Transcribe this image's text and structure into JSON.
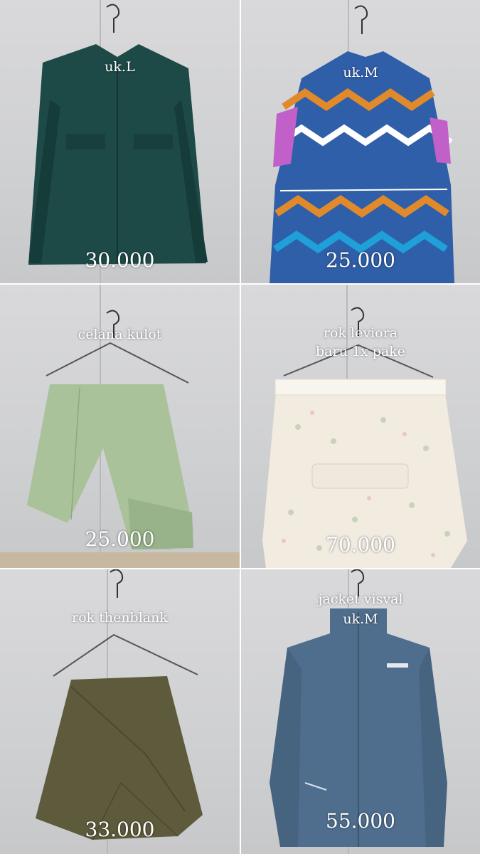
{
  "items": [
    {
      "label": "uk.L",
      "price": "30.000"
    },
    {
      "label": "uk.M",
      "price": "25.000"
    },
    {
      "label": "celana kulot",
      "price": "25.000"
    },
    {
      "label_line1": "rok leviora",
      "label_line2": "baru 1x pake",
      "price": "70.000"
    },
    {
      "label": "rok thenblank",
      "price": "33.000"
    },
    {
      "label_line1": "jacket visval",
      "label_line2": "uk.M",
      "price": "55.000"
    }
  ],
  "colors": {
    "teal_blouse": "#1d4a47",
    "zigzag_dress": "#2f5fa8",
    "kulot_green": "#a9c29a",
    "floral_skirt": "#f1ebe0",
    "olive_skirt": "#5e5a3c",
    "denim_jacket": "#4f6e8e"
  }
}
